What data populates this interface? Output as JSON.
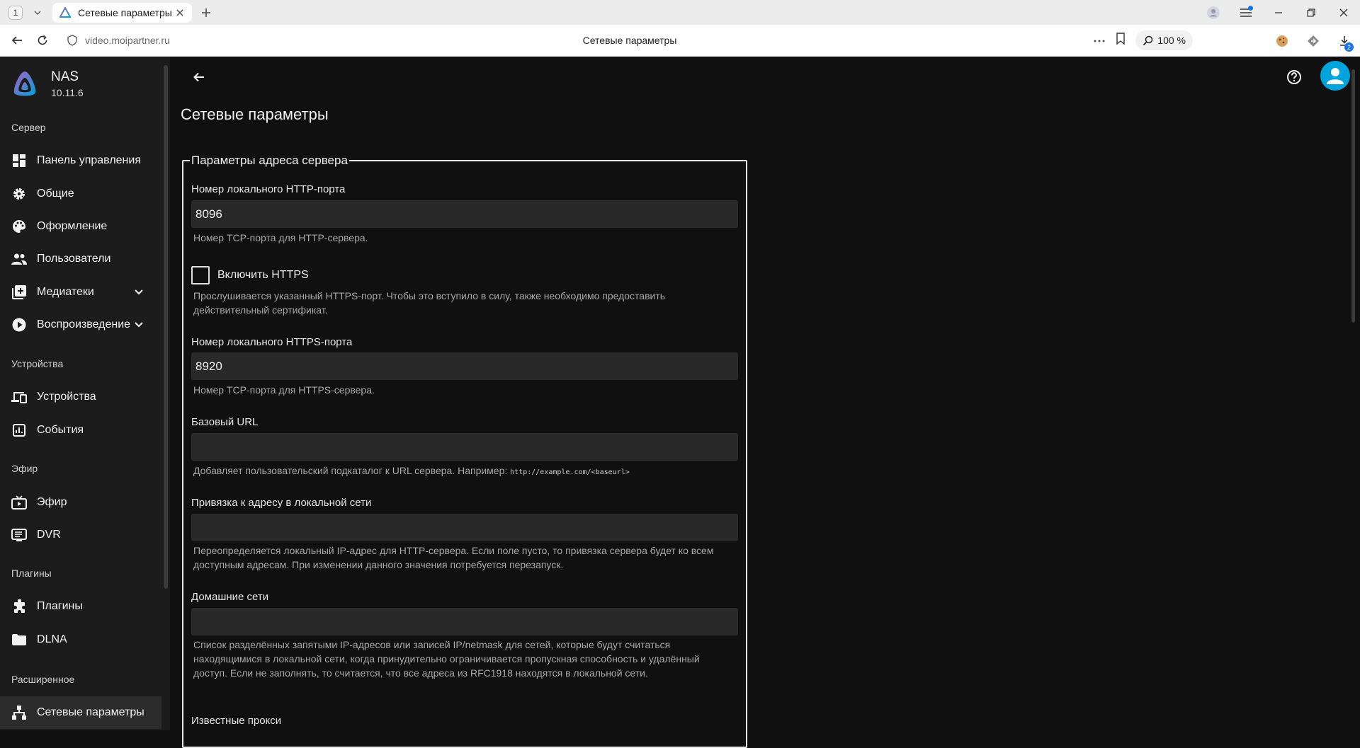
{
  "browser": {
    "tab_count": "1",
    "tab_title": "Сетевые параметры",
    "url": "video.moipartner.ru",
    "center_title": "Сетевые параметры",
    "zoom": "100 %",
    "downloads_badge": "2"
  },
  "app": {
    "name": "NAS",
    "version": "10.11.6"
  },
  "sidebar": {
    "sections": {
      "server": "Сервер",
      "devices": "Устройства",
      "livetv": "Эфир",
      "plugins": "Плагины",
      "advanced": "Расширенное"
    },
    "items": {
      "dashboard": "Панель управления",
      "general": "Общие",
      "branding": "Оформление",
      "users": "Пользователи",
      "libraries": "Медиатеки",
      "playback": "Воспроизведение",
      "devices": "Устройства",
      "activity": "События",
      "livetv": "Эфир",
      "dvr": "DVR",
      "plugins": "Плагины",
      "dlna": "DLNA",
      "networking": "Сетевые параметры"
    }
  },
  "page": {
    "title": "Сетевые параметры",
    "fieldset_legend": "Параметры адреса сервера",
    "http_port": {
      "label": "Номер локального HTTP-порта",
      "value": "8096",
      "help": "Номер TCP-порта для HTTP-сервера."
    },
    "https_enable": {
      "label": "Включить HTTPS",
      "help": "Прослушивается указанный HTTPS-порт. Чтобы это вступило в силу, также необходимо предоставить действительный сертификат."
    },
    "https_port": {
      "label": "Номер локального HTTPS-порта",
      "value": "8920",
      "help": "Номер TCP-порта для HTTPS-сервера."
    },
    "base_url": {
      "label": "Базовый URL",
      "value": "",
      "help": "Добавляет пользовательский подкаталог к URL сервера. Например: ",
      "example": "http://example.com/<baseurl>"
    },
    "local_bind": {
      "label": "Привязка к адресу в локальной сети",
      "value": "",
      "help": "Переопределяется локальный IP-адрес для HTTP-сервера. Если поле пусто, то привязка сервера будет ко всем доступным адресам. При изменении данного значения потребуется перезапуск."
    },
    "home_networks": {
      "label": "Домашние сети",
      "value": "",
      "help": "Список разделённых запятыми IP-адресов или записей IP/netmask для сетей, которые будут считаться находящимися в локальной сети, когда принудительно ограничивается пропускная способность и удалённый доступ. Если не заполнять, то считается, что все адреса из RFC1918 находятся в локальной сети."
    },
    "known_proxies": {
      "label": "Известные прокси"
    }
  },
  "colors": {
    "accent": "#00a4dc",
    "sidebar_bg": "#1c1c1c",
    "main_bg": "#101010",
    "input_bg": "#292929"
  }
}
